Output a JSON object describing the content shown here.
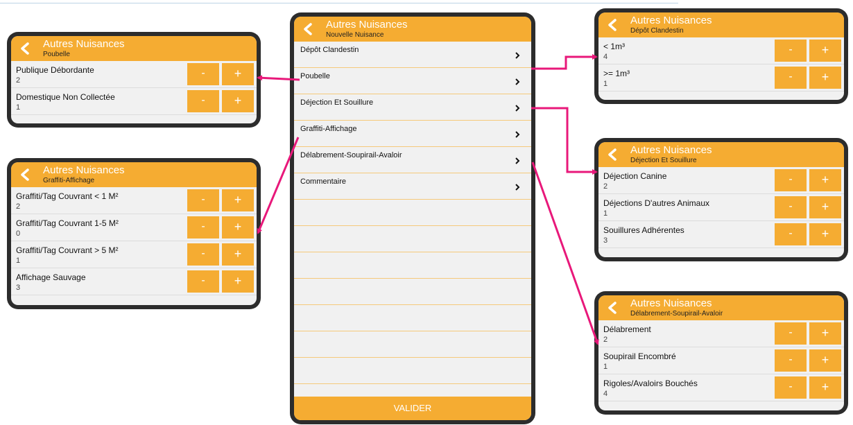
{
  "center": {
    "title": "Autres Nuisances",
    "subtitle": "Nouvelle Nuisance",
    "items": [
      {
        "label": "Dépôt Clandestin"
      },
      {
        "label": "Poubelle"
      },
      {
        "label": "Déjection Et Souillure"
      },
      {
        "label": "Graffiti-Affichage"
      },
      {
        "label": "Délabrement-Soupirail-Avaloir"
      },
      {
        "label": "Commentaire"
      }
    ],
    "validate_label": "VALIDER"
  },
  "poubelle": {
    "title": "Autres Nuisances",
    "subtitle": "Poubelle",
    "rows": [
      {
        "label": "Publique Débordante",
        "value": "2"
      },
      {
        "label": "Domestique Non Collectée",
        "value": "1"
      }
    ]
  },
  "graffiti": {
    "title": "Autres Nuisances",
    "subtitle": "Graffiti-Affichage",
    "rows": [
      {
        "label": "Graffiti/Tag Couvrant < 1 M²",
        "value": "2"
      },
      {
        "label": "Graffiti/Tag Couvrant 1-5 M²",
        "value": "0"
      },
      {
        "label": "Graffiti/Tag Couvrant > 5 M²",
        "value": "1"
      },
      {
        "label": "Affichage Sauvage",
        "value": "3"
      }
    ]
  },
  "depot": {
    "title": "Autres Nuisances",
    "subtitle": "Dépôt Clandestin",
    "rows": [
      {
        "label": "< 1m³",
        "value": "4"
      },
      {
        "label": ">= 1m³",
        "value": "1"
      }
    ]
  },
  "dejection": {
    "title": "Autres Nuisances",
    "subtitle": "Déjection Et Souillure",
    "rows": [
      {
        "label": "Déjection Canine",
        "value": "2"
      },
      {
        "label": "Déjections D'autres Animaux",
        "value": "1"
      },
      {
        "label": "Souillures Adhérentes",
        "value": "3"
      }
    ]
  },
  "delabrement": {
    "title": "Autres Nuisances",
    "subtitle": "Délabrement-Soupirail-Avaloir",
    "rows": [
      {
        "label": "Délabrement",
        "value": "2"
      },
      {
        "label": "Soupirail Encombré",
        "value": "1"
      },
      {
        "label": "Rigoles/Avaloirs Bouchés",
        "value": "4"
      }
    ]
  },
  "buttons": {
    "minus": "-",
    "plus": "+"
  },
  "icons": {
    "back": "chevron-left-icon",
    "row": "chevron-right-icon"
  },
  "colors": {
    "accent": "#f5ac32",
    "frame": "#2c2c2c",
    "arrow": "#e8187a",
    "row_bg": "#f1f1f1"
  }
}
